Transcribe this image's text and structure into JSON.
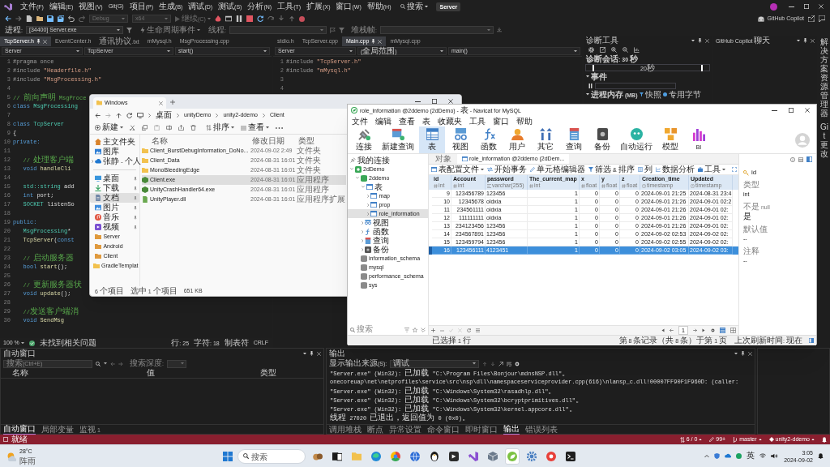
{
  "ide": {
    "menu": [
      "文件(F)",
      "编辑(E)",
      "视图(V)",
      "Git(G)",
      "项目(P)",
      "生成(B)",
      "调试(D)",
      "测试(S)",
      "分析(N)",
      "工具(T)",
      "扩展(X)",
      "窗口(W)",
      "帮助(H)"
    ],
    "search": "搜索",
    "solution": "Server",
    "copilot": "GitHub Copilot",
    "toolbar": [
      {
        "kind": "dropdown",
        "label": "Debug",
        "disabled": true
      },
      {
        "kind": "dropdown",
        "label": "x64",
        "disabled": true
      },
      {
        "kind": "button",
        "label": "继续(C)",
        "disabled": true
      }
    ],
    "debug_location": {
      "process_label": "进程:",
      "process": "[34400] Server.exe",
      "lifecycle": "生命周期事件",
      "thread_label": "线程:",
      "frame_label": "堆栈帧:"
    },
    "editor_groups": [
      {
        "tabs": [
          {
            "label": "TcpServer.h",
            "selected": true
          },
          {
            "label": "EventCenter.h",
            "selected": false
          },
          {
            "label": "通讯协议.txt",
            "selected": false
          },
          {
            "label": "mMysql.h",
            "selected": false
          },
          {
            "label": "MsgProcessing.cpp",
            "selected": false
          }
        ],
        "nav": [
          "Server",
          "TcpServer",
          "start()"
        ],
        "lines": [
          {
            "num": "1",
            "tokens": [
              {
                "text": "#pragma once",
                "kind": "pre"
              }
            ]
          },
          {
            "num": "2",
            "tokens": [
              {
                "text": "#include ",
                "kind": "pre"
              },
              {
                "text": "\"Headerfile.h\"",
                "kind": "str"
              }
            ]
          },
          {
            "num": "3",
            "tokens": [
              {
                "text": "#include ",
                "kind": "pre"
              },
              {
                "text": "\"MsgProcessing.h\"",
                "kind": "str"
              }
            ]
          },
          {
            "num": "4"
          },
          {
            "num": "5",
            "tokens": [
              {
                "text": "// 前向声明 MsgProce",
                "kind": "com"
              }
            ]
          },
          {
            "num": "6",
            "tokens": [
              {
                "text": "class ",
                "kind": "kw"
              },
              {
                "text": "MsgProcessing",
                "kind": "type"
              }
            ]
          },
          {
            "num": "7"
          },
          {
            "num": "8",
            "tokens": [
              {
                "text": "class ",
                "kind": "kw"
              },
              {
                "text": "TcpServer",
                "kind": "type"
              }
            ]
          },
          {
            "num": "9",
            "tokens": [
              {
                "text": "{",
                "kind": "plain"
              }
            ]
          },
          {
            "num": "10",
            "tokens": [
              {
                "text": "private:",
                "kind": "kw"
              }
            ]
          },
          {
            "num": "11"
          },
          {
            "num": "12",
            "tokens": [
              {
                "text": "   // 处理客户端",
                "kind": "com"
              }
            ]
          },
          {
            "num": "13",
            "tokens": [
              {
                "text": "   void ",
                "kind": "kw"
              },
              {
                "text": "handleCli",
                "kind": "fn"
              }
            ]
          },
          {
            "num": "14"
          },
          {
            "num": "15",
            "tokens": [
              {
                "text": "   std::string",
                "kind": "type"
              },
              {
                "text": " add",
                "kind": "plain"
              }
            ]
          },
          {
            "num": "16",
            "tokens": [
              {
                "text": "   int ",
                "kind": "kw"
              },
              {
                "text": "port;",
                "kind": "plain"
              }
            ]
          },
          {
            "num": "17",
            "tokens": [
              {
                "text": "   SOCKET ",
                "kind": "type"
              },
              {
                "text": "listenSo",
                "kind": "plain"
              }
            ]
          },
          {
            "num": "18"
          },
          {
            "num": "19",
            "tokens": [
              {
                "text": "public:",
                "kind": "kw"
              }
            ]
          },
          {
            "num": "20",
            "tokens": [
              {
                "text": "   MsgProcessing",
                "kind": "type"
              },
              {
                "text": "*",
                "kind": "plain"
              }
            ]
          },
          {
            "num": "21",
            "tokens": [
              {
                "text": "   TcpServer",
                "kind": "fn"
              },
              {
                "text": "(",
                "kind": "plain"
              },
              {
                "text": "const",
                "kind": "kw"
              }
            ]
          },
          {
            "num": "22"
          },
          {
            "num": "23",
            "tokens": [
              {
                "text": "   // 启动服务器",
                "kind": "com"
              }
            ]
          },
          {
            "num": "24",
            "tokens": [
              {
                "text": "   bool ",
                "kind": "kw"
              },
              {
                "text": "start",
                "kind": "fn"
              },
              {
                "text": "();",
                "kind": "plain"
              }
            ]
          },
          {
            "num": "25"
          },
          {
            "num": "26",
            "tokens": [
              {
                "text": "   // 更新服务器状",
                "kind": "com"
              }
            ]
          },
          {
            "num": "27",
            "tokens": [
              {
                "text": "   void ",
                "kind": "kw"
              },
              {
                "text": "update",
                "kind": "fn"
              },
              {
                "text": "();",
                "kind": "plain"
              }
            ]
          },
          {
            "num": "28"
          },
          {
            "num": "29",
            "tokens": [
              {
                "text": "   //发送客户端消",
                "kind": "com"
              }
            ]
          },
          {
            "num": "30",
            "tokens": [
              {
                "text": "   void ",
                "kind": "kw"
              },
              {
                "text": "SendMsg",
                "kind": "fn"
              }
            ]
          }
        ]
      },
      {
        "tabs": [
          {
            "label": "stdio.h",
            "selected": false
          },
          {
            "label": "TcpServer.cpp",
            "selected": false
          },
          {
            "label": "Main.cpp",
            "selected": true
          },
          {
            "label": "mMysql.cpp",
            "selected": false
          }
        ],
        "nav": [
          "Server",
          "(全局范围)",
          "main()"
        ],
        "lines": [
          {
            "num": "1",
            "tokens": [
              {
                "text": "#include ",
                "kind": "pre"
              },
              {
                "text": "\"TcpServer.h\"",
                "kind": "str"
              }
            ]
          },
          {
            "num": "2",
            "tokens": [
              {
                "text": "#include ",
                "kind": "pre"
              },
              {
                "text": "\"mMysql.h\"",
                "kind": "str"
              }
            ]
          },
          {
            "num": "3"
          },
          {
            "num": "4"
          }
        ]
      }
    ],
    "editor_status": {
      "zoom": "100 %",
      "issues": "未找到相关问题",
      "line": "行: 25",
      "char": "字符: 18",
      "indent": "制表符",
      "eol": "CRLF"
    },
    "diagnostics": {
      "title": "诊断工具",
      "session": "诊断会话: 30 秒",
      "tick": "20秒",
      "events": "事件",
      "memory": "进程内存 (MB)",
      "snapshot": "快照",
      "private_bytes": "专用字节"
    },
    "copilot_chat": {
      "title": "GitHub Copilot 聊天"
    },
    "side_tabs": [
      "解决方案资源管理器",
      "Git 更改"
    ],
    "autos": {
      "title": "自动窗口",
      "search": {
        "placeholder": "搜索(Ctrl+E)"
      },
      "depth_label": "搜索深度:",
      "columns": [
        "名称",
        "值",
        "类型"
      ],
      "tabs": [
        {
          "label": "自动窗口",
          "selected": true
        },
        {
          "label": "局部变量",
          "selected": false
        },
        {
          "label": "监视 1",
          "selected": false
        }
      ]
    },
    "output": {
      "title": "输出",
      "source_label": "显示输出来源(S):",
      "source": "调试",
      "lines": [
        "\"Server.exe\" (Win32): 已加载 \"C:\\Program Files\\Bonjour\\mdnsNSP.dll\"。",
        "onecoreuap\\net\\netprofiles\\service\\src\\nsp\\dll\\namespaceserviceprovider.cpp(616)\\nlansp_c.dll!00007FF90F1F960D: (caller:",
        "\"Server.exe\" (Win32): 已加载 \"C:\\Windows\\System32\\rasadhlp.dll\"。",
        "\"Server.exe\" (Win32): 已加载 \"C:\\Windows\\System32\\bcryptprimitives.dll\"。",
        "\"Server.exe\" (Win32): 已加载 \"C:\\Windows\\System32\\kernel.appcore.dll\"。",
        "线程 27020 已退出，返回值为 0 (0x0)。"
      ],
      "tabs": [
        {
          "label": "调用堆栈",
          "selected": false
        },
        {
          "label": "断点",
          "selected": false
        },
        {
          "label": "异常设置",
          "selected": false
        },
        {
          "label": "命令窗口",
          "selected": false
        },
        {
          "label": "即时窗口",
          "selected": false
        },
        {
          "label": "输出",
          "selected": true
        },
        {
          "label": "错误列表",
          "selected": false
        }
      ]
    },
    "status_bar": {
      "state": "就绪",
      "sync": "6 / 0",
      "changes": "99+",
      "branch": "master",
      "repository": "unity2-ddemo"
    }
  },
  "explorer": {
    "tab": "Windows",
    "breadcrumb": [
      "桌面",
      "unityDemo",
      "unity2-ddemo",
      "Client"
    ],
    "commands": {
      "new": "新建",
      "sort": "排序",
      "view": "查看"
    },
    "nav_groups": [
      [
        {
          "label": "主文件夹",
          "kind": "home",
          "pinned": false,
          "selected": false
        },
        {
          "label": "图库",
          "kind": "gallery",
          "pinned": false,
          "selected": false
        },
        {
          "label": "张静 - 个人",
          "kind": "cloud",
          "pinned": false,
          "selected": false
        }
      ],
      [
        {
          "label": "桌面",
          "kind": "desktop",
          "pinned": true,
          "selected": false
        },
        {
          "label": "下载",
          "kind": "download",
          "pinned": true,
          "selected": false
        },
        {
          "label": "文档",
          "kind": "documents",
          "pinned": true,
          "selected": true
        },
        {
          "label": "图片",
          "kind": "pictures",
          "pinned": true,
          "selected": false
        },
        {
          "label": "音乐",
          "kind": "music",
          "pinned": true,
          "selected": false
        },
        {
          "label": "视频",
          "kind": "videos",
          "pinned": true,
          "selected": false
        },
        {
          "label": "Server",
          "kind": "project",
          "pinned": false,
          "selected": false
        },
        {
          "label": "Android",
          "kind": "project",
          "pinned": false,
          "selected": false
        },
        {
          "label": "Client",
          "kind": "project",
          "pinned": false,
          "selected": false
        },
        {
          "label": "GradleTemplat",
          "kind": "folder",
          "pinned": false,
          "selected": false
        }
      ]
    ],
    "columns": [
      "名称",
      "修改日期",
      "类型"
    ],
    "files": [
      {
        "name": "Client_BurstDebugInformation_DoNo...",
        "modified": "2024-09-02 2:49",
        "type": "文件夹",
        "kind": "folder",
        "selected": false
      },
      {
        "name": "Client_Data",
        "modified": "2024-08-31 16:01",
        "type": "文件夹",
        "kind": "folder",
        "selected": false
      },
      {
        "name": "MonoBleedingEdge",
        "modified": "2024-08-31 16:01",
        "type": "文件夹",
        "kind": "folder",
        "selected": false
      },
      {
        "name": "Client.exe",
        "modified": "2024-08-31 16:01",
        "type": "应用程序",
        "kind": "app",
        "selected": true
      },
      {
        "name": "UnityCrashHandler64.exe",
        "modified": "2024-08-31 16:01",
        "type": "应用程序",
        "kind": "app",
        "selected": false
      },
      {
        "name": "UnityPlayer.dll",
        "modified": "2024-08-31 16:01",
        "type": "应用程序扩展",
        "kind": "library",
        "selected": false
      }
    ],
    "status": {
      "count": "6 个项目",
      "selection": "选中 1 个项目",
      "size": "651 KB"
    }
  },
  "navicat": {
    "title": "role_information @2ddemo (2dDemo) - 表 - Navicat for MySQL",
    "menu": [
      "文件",
      "编辑",
      "查看",
      "表",
      "收藏夹",
      "工具",
      "窗口",
      "帮助"
    ],
    "tools": [
      {
        "label": "连接",
        "kind": "connect",
        "selected": false
      },
      {
        "label": "新建查询",
        "kind": "new_query",
        "selected": false
      },
      {
        "label": "表",
        "kind": "table",
        "selected": true
      },
      {
        "label": "视图",
        "kind": "view",
        "selected": false
      },
      {
        "label": "函数",
        "kind": "function",
        "selected": false
      },
      {
        "label": "用户",
        "kind": "user",
        "selected": false
      },
      {
        "label": "其它",
        "kind": "other",
        "selected": false
      },
      {
        "label": "查询",
        "kind": "query",
        "selected": false
      },
      {
        "label": "备份",
        "kind": "backup",
        "selected": false
      },
      {
        "label": "自动运行",
        "kind": "automation",
        "selected": false
      },
      {
        "label": "模型",
        "kind": "model",
        "selected": false
      },
      {
        "label": "BI",
        "kind": "bi",
        "selected": false
      }
    ],
    "tree": {
      "title": "我的连接",
      "items": [
        {
          "label": "2dDemo",
          "kind": "connection",
          "expanded": true,
          "selected": false,
          "children": [
            {
              "label": "2ddemo",
              "kind": "database",
              "expanded": true,
              "selected": false,
              "children": [
                {
                  "label": "表",
                  "kind": "tables",
                  "expanded": true,
                  "selected": false,
                  "children": [
                    {
                      "label": "map",
                      "kind": "table",
                      "expanded": false,
                      "selected": false
                    },
                    {
                      "label": "prop",
                      "kind": "table",
                      "expanded": false,
                      "selected": false
                    },
                    {
                      "label": "role_information",
                      "kind": "table",
                      "expanded": false,
                      "selected": true
                    }
                  ]
                },
                {
                  "label": "视图",
                  "kind": "views",
                  "expanded": false,
                  "selected": false
                },
                {
                  "label": "函数",
                  "kind": "functions",
                  "expanded": false,
                  "selected": false
                },
                {
                  "label": "查询",
                  "kind": "queries",
                  "expanded": false,
                  "selected": false
                },
                {
                  "label": "备份",
                  "kind": "backups",
                  "expanded": false,
                  "selected": false
                }
              ]
            },
            {
              "label": "information_schema",
              "kind": "schema",
              "selected": false
            },
            {
              "label": "mysql",
              "kind": "schema",
              "selected": false
            },
            {
              "label": "performance_schema",
              "kind": "schema",
              "selected": false
            },
            {
              "label": "sys",
              "kind": "schema",
              "selected": false
            }
          ]
        }
      ],
      "search": {
        "placeholder": "搜索"
      }
    },
    "tabs": [
      {
        "label": "对象",
        "kind": "objects",
        "selected": false
      },
      {
        "label": "role_information @2ddemo (2dDem...",
        "kind": "table",
        "selected": true
      }
    ],
    "table_tools": [
      {
        "label": "表配置文件",
        "kind": "profile",
        "dropdown": true
      },
      {
        "label": "开始事务",
        "kind": "transaction",
        "dropdown": false
      },
      {
        "label": "单元格编辑器",
        "kind": "cell_editor",
        "dropdown": false
      },
      {
        "label": "筛选 & 排序",
        "kind": "filter",
        "dropdown": false
      },
      {
        "label": "列",
        "kind": "columns",
        "dropdown": false
      },
      {
        "label": "数据分析",
        "kind": "analysis",
        "dropdown": false
      },
      {
        "label": "工具",
        "kind": "tools",
        "dropdown": true
      }
    ],
    "columns": [
      {
        "name": "id",
        "type": "int",
        "kind": "number"
      },
      {
        "name": "Account",
        "type": "int",
        "kind": "number"
      },
      {
        "name": "password",
        "type": "varchar(255)",
        "kind": "text"
      },
      {
        "name": "The_current_map",
        "type": "int",
        "kind": "number"
      },
      {
        "name": "x",
        "type": "float",
        "kind": "number"
      },
      {
        "name": "y",
        "type": "float",
        "kind": "number"
      },
      {
        "name": "z",
        "type": "float",
        "kind": "number"
      },
      {
        "name": "Creation_time",
        "type": "timestamp",
        "kind": "time"
      },
      {
        "name": "Updated",
        "type": "timestamp",
        "kind": "time"
      }
    ],
    "rows": [
      {
        "cells": [
          "9",
          "123456789",
          "123456",
          "1",
          "0",
          "0",
          "0",
          "2024-09-01 21:25",
          "2024-08-31 23:4"
        ],
        "selected": false
      },
      {
        "cells": [
          "10",
          "12345678",
          "oldxia",
          "1",
          "0",
          "0",
          "0",
          "2024-09-01 21:26",
          "2024-09-01 02:2"
        ],
        "selected": false
      },
      {
        "cells": [
          "11",
          "234561111",
          "oldxia",
          "1",
          "0",
          "0",
          "0",
          "2024-09-01 21:26",
          "2024-09-01 02:"
        ],
        "selected": false
      },
      {
        "cells": [
          "12",
          "111111111",
          "oldxia",
          "1",
          "0",
          "0",
          "0",
          "2024-09-01 21:26",
          "2024-09-01 02:"
        ],
        "selected": false
      },
      {
        "cells": [
          "13",
          "234123456",
          "123456",
          "1",
          "0",
          "0",
          "0",
          "2024-09-01 21:26",
          "2024-09-01 02:"
        ],
        "selected": false
      },
      {
        "cells": [
          "14",
          "234567891",
          "123456",
          "1",
          "0",
          "0",
          "0",
          "2024-09-02 02:53",
          "2024-09-02 02:"
        ],
        "selected": false
      },
      {
        "cells": [
          "15",
          "123459794",
          "123456",
          "1",
          "0",
          "0",
          "0",
          "2024-09-02 02:55",
          "2024-09-02 02:"
        ],
        "selected": false
      },
      {
        "cells": [
          "16",
          "123456111",
          "4123451",
          "1",
          "0",
          "0",
          "0",
          "2024-09-02 03:05",
          "2024-09-02 03:"
        ],
        "selected": true
      }
    ],
    "pager": {
      "page": "1"
    },
    "info": {
      "field": "id",
      "properties": [
        {
          "label": "类型",
          "value": "int"
        },
        {
          "label": "不是 null",
          "value": "是"
        },
        {
          "label": "默认值",
          "value": "--"
        },
        {
          "label": "注释",
          "value": "--"
        }
      ]
    },
    "status": {
      "selection": "已选择 1 行",
      "records": "第 8 条记录（共 8 条）于第 1 页",
      "refreshed": "上次刷新时间: 现在"
    }
  },
  "taskbar": {
    "weather": {
      "temperature": "28°C",
      "condition": "阵雨"
    },
    "search": {
      "placeholder": "搜索"
    },
    "apps": [
      {
        "kind": "widgets",
        "selected": false
      },
      {
        "kind": "taskview",
        "selected": false
      },
      {
        "kind": "folder",
        "selected": false
      },
      {
        "kind": "edge",
        "selected": false
      },
      {
        "kind": "chrome",
        "selected": false
      },
      {
        "kind": "globe",
        "selected": false
      },
      {
        "kind": "penguin",
        "selected": false
      },
      {
        "kind": "dark",
        "selected": false
      },
      {
        "kind": "vs",
        "selected": false
      },
      {
        "kind": "cube",
        "selected": false
      },
      {
        "kind": "navicat",
        "selected": true
      },
      {
        "kind": "gear",
        "selected": false
      },
      {
        "kind": "recorder",
        "selected": false
      },
      {
        "kind": "terminal",
        "selected": false
      }
    ],
    "tray": {
      "ime": "英",
      "time": "3:05",
      "date": "2024-09-02"
    }
  }
}
